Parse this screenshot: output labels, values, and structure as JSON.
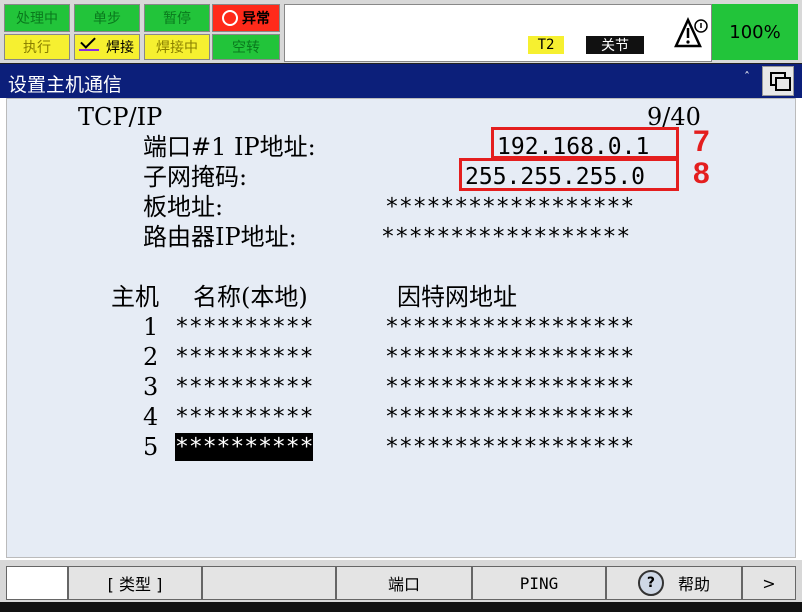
{
  "status": {
    "processing": "处理中",
    "step": "单步",
    "pause": "暂停",
    "alarm": "异常",
    "execute": "执行",
    "welding": "焊接",
    "welding_in_progress": "焊接中",
    "dry_run": "空转",
    "coordinate": "T2",
    "joint": "关节",
    "speed": "100%"
  },
  "window": {
    "title": "设置主机通信"
  },
  "tcpip": {
    "label": "TCP/IP",
    "page": "9/40",
    "port_ip_label": "端口#1 IP地址:",
    "port_ip_value": "192.168.0.1",
    "subnet_label": "子网掩码:",
    "subnet_value": "255.255.255.0",
    "board_label": "板地址:",
    "board_value": "******************",
    "router_label": "路由器IP地址:",
    "router_value": "******************"
  },
  "annotations": {
    "ip_marker": "7",
    "subnet_marker": "8"
  },
  "host_table": {
    "header_host": "主机",
    "header_name": "名称(本地)",
    "header_address": "因特网地址",
    "rows": [
      {
        "index": "1",
        "name": "**********",
        "address": "******************"
      },
      {
        "index": "2",
        "name": "**********",
        "address": "******************"
      },
      {
        "index": "3",
        "name": "**********",
        "address": "******************"
      },
      {
        "index": "4",
        "name": "**********",
        "address": "******************"
      },
      {
        "index": "5",
        "name": "**********",
        "address": "******************"
      }
    ]
  },
  "footer": {
    "type_key": "[ 类型 ]",
    "port_key": "端口",
    "ping_key": "PING",
    "help_key": "帮助",
    "next_key": ">"
  },
  "colors": {
    "title_bar": "#0c1f7a",
    "status_green": "#22c43a",
    "status_yellow": "#f6f030",
    "status_red": "#ff2a1a",
    "annotation_red": "#e41e1e",
    "content_bg": "#e6ecf5"
  },
  "icons": [
    "alarm-circle-icon",
    "weld-check-icon",
    "warning-triangle-icon",
    "caret-up-icon",
    "window-restore-icon",
    "help-icon",
    "next-arrow-icon"
  ]
}
